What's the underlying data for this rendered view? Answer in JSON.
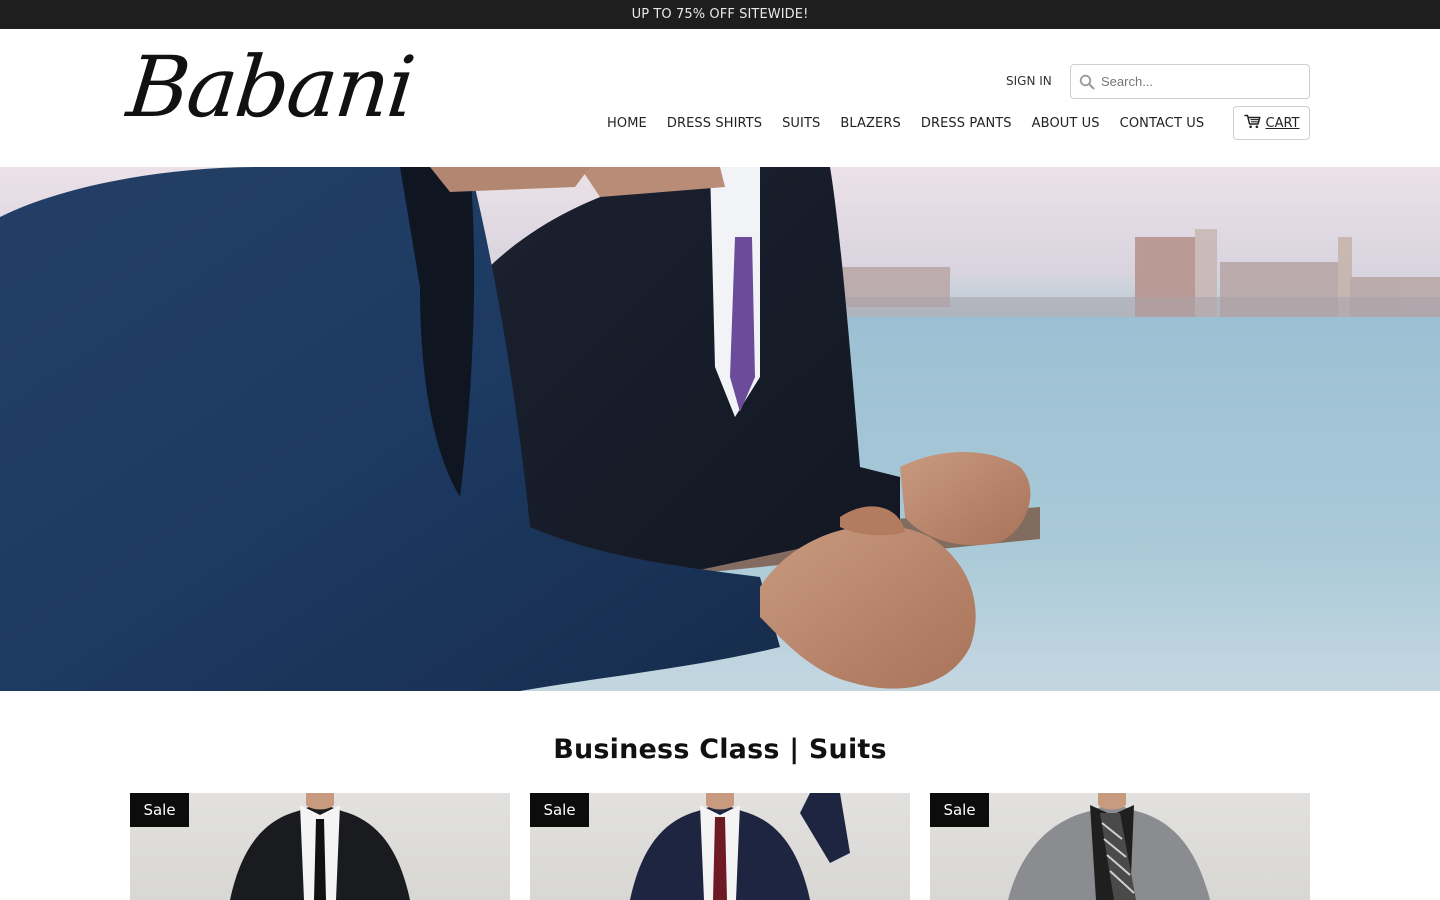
{
  "announcement": {
    "text": "UP TO 75% OFF SITEWIDE!"
  },
  "header": {
    "logo_text": "Babani",
    "sign_in": "SIGN IN",
    "search": {
      "placeholder": "Search...",
      "value": ""
    },
    "nav": [
      "HOME",
      "DRESS SHIRTS",
      "SUITS",
      "BLAZERS",
      "DRESS PANTS",
      "ABOUT US",
      "CONTACT US"
    ],
    "cart_label": "CART"
  },
  "section": {
    "title": "Business Class | Suits",
    "products": [
      {
        "badge": "Sale",
        "suit_color": "#1a1b1e",
        "tie_color": "#111111"
      },
      {
        "badge": "Sale",
        "suit_color": "#1d2540",
        "tie_color": "#6e1a24"
      },
      {
        "badge": "Sale",
        "suit_color": "#8a8c8f",
        "tie_color": "#2a2a2a"
      }
    ]
  },
  "colors": {
    "announcement_bg": "#1e1e1e",
    "text": "#222222",
    "badge_bg": "#0c0c0c",
    "border": "#cfcfcf"
  }
}
